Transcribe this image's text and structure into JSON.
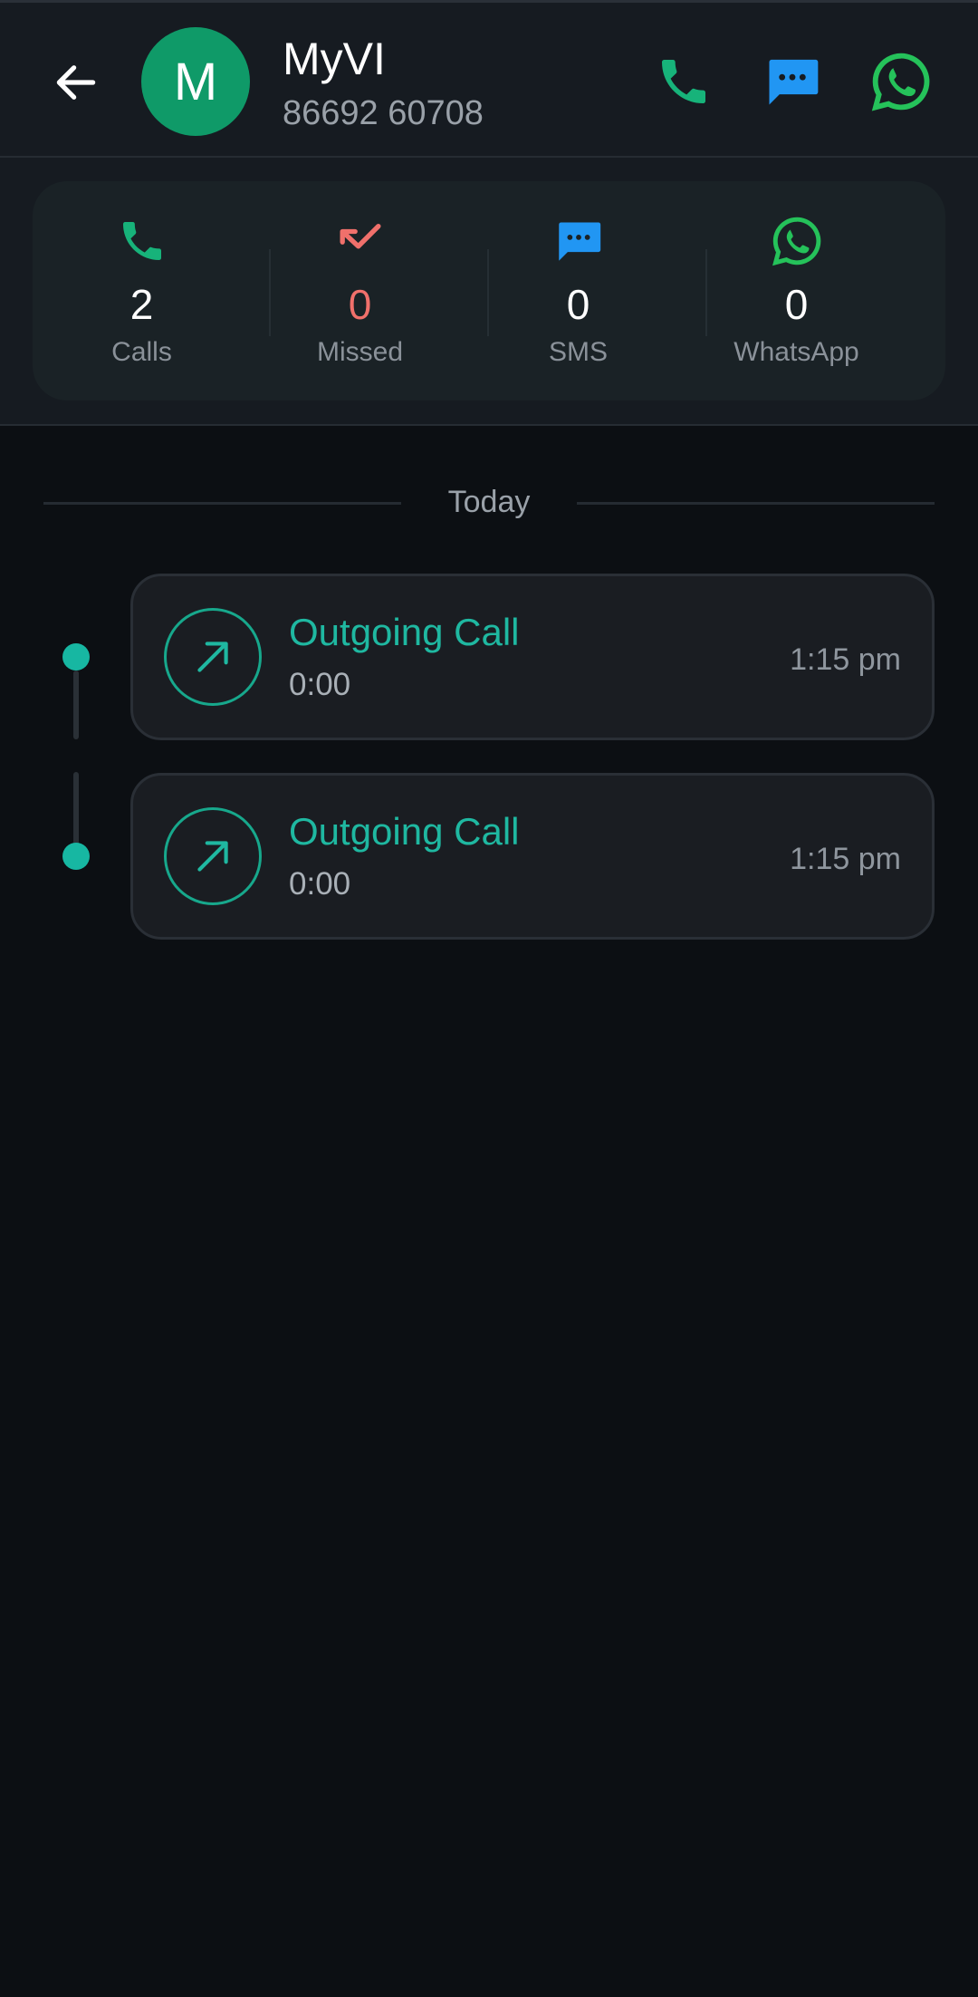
{
  "header": {
    "back_icon": "arrow-left-icon",
    "avatar_letter": "M",
    "contact_name": "MyVI",
    "contact_number": "86692 60708",
    "actions": [
      {
        "icon": "phone-icon",
        "color": "#17b37a"
      },
      {
        "icon": "message-icon",
        "color": "#2196f3"
      },
      {
        "icon": "whatsapp-icon",
        "color": "#25c25a"
      }
    ]
  },
  "stats": [
    {
      "icon": "phone-icon",
      "value": "2",
      "label": "Calls",
      "value_color": "#ffffff",
      "icon_color": "#17b37a"
    },
    {
      "icon": "missed-call-icon",
      "value": "0",
      "label": "Missed",
      "value_color": "#f0706b",
      "icon_color": "#f0706b"
    },
    {
      "icon": "message-icon",
      "value": "0",
      "label": "SMS",
      "value_color": "#ffffff",
      "icon_color": "#2196f3"
    },
    {
      "icon": "whatsapp-icon",
      "value": "0",
      "label": "WhatsApp",
      "value_color": "#ffffff",
      "icon_color": "#25c25a"
    }
  ],
  "timeline": {
    "date_label": "Today",
    "calls": [
      {
        "icon": "outgoing-arrow-icon",
        "type": "Outgoing Call",
        "duration": "0:00",
        "time": "1:15 pm"
      },
      {
        "icon": "outgoing-arrow-icon",
        "type": "Outgoing Call",
        "duration": "0:00",
        "time": "1:15 pm"
      }
    ]
  },
  "colors": {
    "accent": "#1fb8a1",
    "background": "#0c0f13",
    "header_bg": "#161b21"
  }
}
